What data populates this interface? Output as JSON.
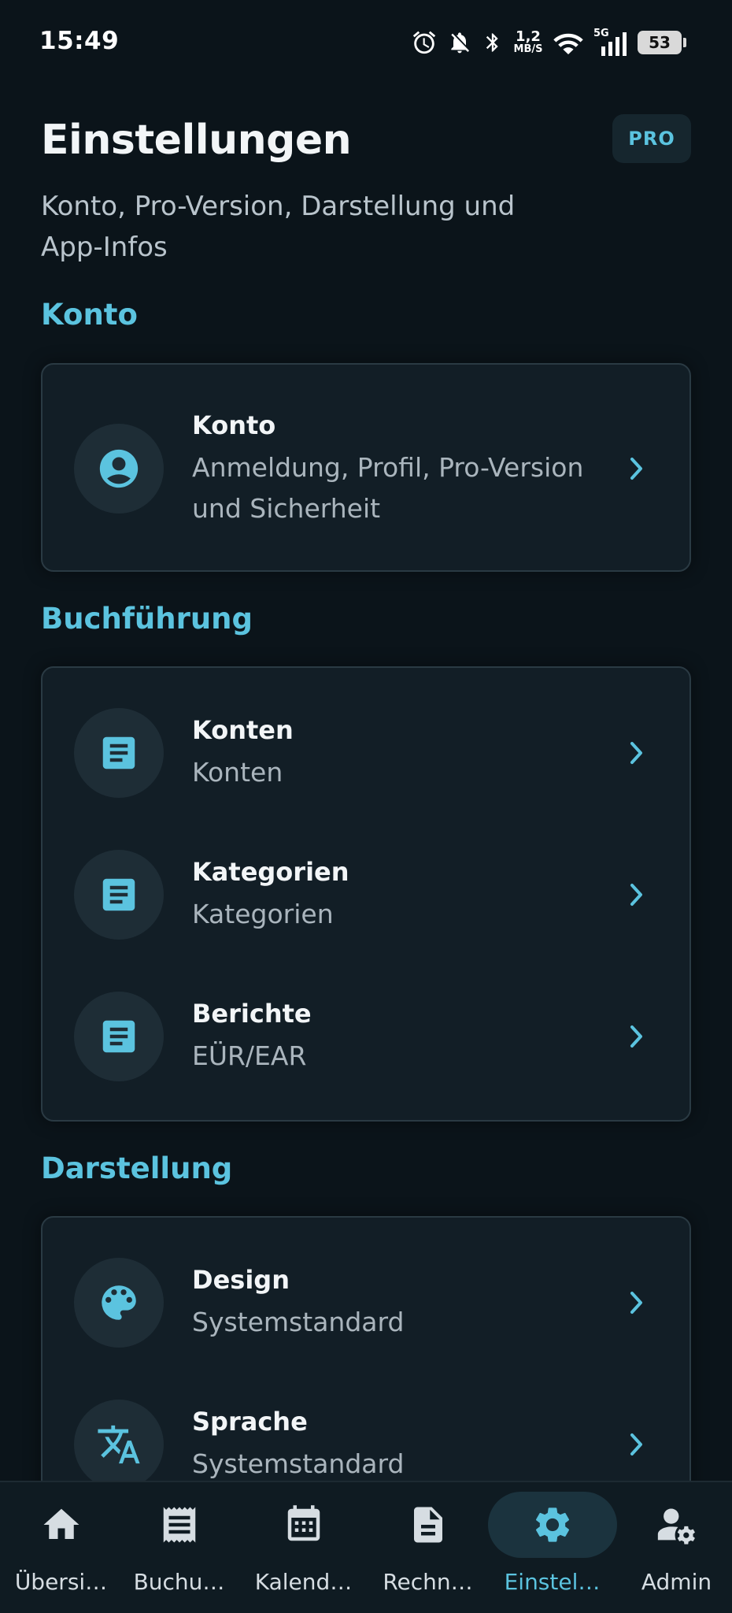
{
  "status_bar": {
    "time": "15:49",
    "net_speed_value": "1,2",
    "net_speed_unit": "MB/S",
    "network_type": "5G",
    "battery": "53"
  },
  "header": {
    "title": "Einstellungen",
    "badge": "PRO",
    "subtitle": "Konto, Pro-Version, Darstellung und App-Infos"
  },
  "sections": [
    {
      "label": "Konto",
      "items": [
        {
          "title": "Konto",
          "subtitle": "Anmeldung, Profil, Pro-Version und Sicherheit",
          "icon": "account-circle-icon"
        }
      ]
    },
    {
      "label": "Buchführung",
      "items": [
        {
          "title": "Konten",
          "subtitle": "Konten",
          "icon": "document-icon"
        },
        {
          "title": "Kategorien",
          "subtitle": "Kategorien",
          "icon": "document-icon"
        },
        {
          "title": "Berichte",
          "subtitle": "EÜR/EAR",
          "icon": "document-icon"
        }
      ]
    },
    {
      "label": "Darstellung",
      "items": [
        {
          "title": "Design",
          "subtitle": "Systemstandard",
          "icon": "palette-icon"
        },
        {
          "title": "Sprache",
          "subtitle": "Systemstandard",
          "icon": "translate-icon"
        }
      ]
    }
  ],
  "bottom_nav": {
    "items": [
      {
        "label": "Übersi…",
        "icon": "home-icon"
      },
      {
        "label": "Buchu…",
        "icon": "receipt-icon"
      },
      {
        "label": "Kalend…",
        "icon": "calendar-icon"
      },
      {
        "label": "Rechn…",
        "icon": "invoice-icon"
      },
      {
        "label": "Einstel…",
        "icon": "settings-icon",
        "active": true
      },
      {
        "label": "Admin",
        "icon": "admin-icon"
      }
    ]
  },
  "colors": {
    "background": "#0b141a",
    "accent": "#5bc3df",
    "card": "#121e26",
    "card_border": "#2a3a43",
    "icon_circle": "#1e2d36",
    "nav_background": "#0f1b22",
    "nav_active_pill": "#1b333e"
  }
}
